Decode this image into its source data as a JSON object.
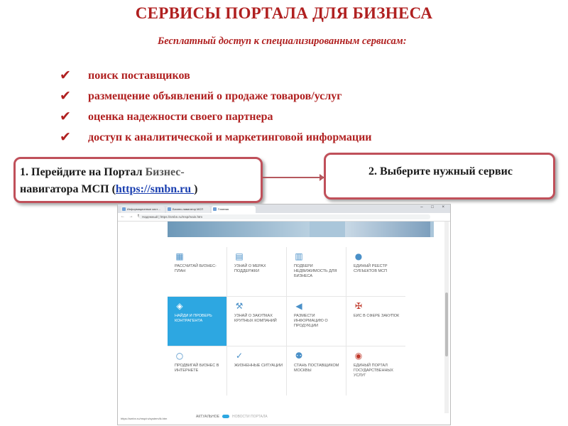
{
  "slide": {
    "title": "СЕРВИСЫ ПОРТАЛА ДЛЯ БИЗНЕСА",
    "subtitle": "Бесплатный доступ к специализированным сервисам:",
    "bullets": [
      "поиск поставщиков",
      "размещение объявлений о продаже товаров/услуг",
      "оценка надежности своего партнера",
      "доступ к аналитической и маркетинговой информации"
    ],
    "step1": {
      "text_a": "1. Перейдите на Портал ",
      "text_b": "Бизнес-",
      "text_c": "навигатора МСП (",
      "link": "https://smbn.ru ",
      "text_d": ")"
    },
    "step2": "2.   Выберите нужный сервис",
    "accent_color": "#b02020"
  },
  "browser": {
    "tabs": [
      "Информационные сист…",
      "Бизнес-навигатор МСП",
      "Главная"
    ],
    "window_controls": "–  □  ×",
    "nav_icons": "←  →  ↻",
    "url": "Надежный | https://smbn.ru/msp/main.htm",
    "status_url": "https://smbn.ru/msp/ru/system/lk.htm",
    "footer_left": "АКТУАЛЬНОЕ",
    "footer_right": "НОВОСТИ ПОРТАЛА"
  },
  "tiles": [
    {
      "label": "РАССЧИТАЙ БИЗНЕС-ПЛАН",
      "icon": "calculator-icon",
      "glyph": "▦",
      "selected": false
    },
    {
      "label": "УЗНАЙ О МЕРАХ ПОДДЕРЖКИ",
      "icon": "document-icon",
      "glyph": "▤",
      "selected": false
    },
    {
      "label": "ПОДБЕРИ НЕДВИЖИМОСТЬ ДЛЯ БИЗНЕСА",
      "icon": "building-icon",
      "glyph": "▥",
      "selected": false
    },
    {
      "label": "ЕДИНЫЙ РЕЕСТР СУБЪЕКТОВ МСП",
      "icon": "registry-icon",
      "glyph": "●",
      "selected": false
    },
    {
      "label": "НАЙДИ И ПРОВЕРЬ КОНТРАГЕНТА",
      "icon": "network-icon",
      "glyph": "◈",
      "selected": true
    },
    {
      "label": "УЗНАЙ О ЗАКУПКАХ КРУПНЫХ КОМПАНИЙ",
      "icon": "gavel-icon",
      "glyph": "⚒",
      "selected": false
    },
    {
      "label": "РАЗМЕСТИ ИНФОРМАЦИЮ О ПРОДУКЦИИ",
      "icon": "megaphone-icon",
      "glyph": "◀",
      "selected": false
    },
    {
      "label": "ЕИС В СФЕРЕ ЗАКУПОК",
      "icon": "emblem-icon",
      "glyph": "✠",
      "selected": false
    },
    {
      "label": "ПРОДВИГАЙ БИЗНЕС В ИНТЕРНЕТЕ",
      "icon": "circle-icon",
      "glyph": "○",
      "selected": false
    },
    {
      "label": "ЖИЗНЕННЫЕ СИТУАЦИИ",
      "icon": "check-icon",
      "glyph": "✓",
      "selected": false
    },
    {
      "label": "СТАНЬ ПОСТАВЩИКОМ МОСКВЫ",
      "icon": "people-icon",
      "glyph": "⚉",
      "selected": false
    },
    {
      "label": "ЕДИНЫЙ ПОРТАЛ ГОСУДАРСТВЕННЫХ УСЛУГ",
      "icon": "gosuslugi-icon",
      "glyph": "◉",
      "selected": false
    }
  ]
}
